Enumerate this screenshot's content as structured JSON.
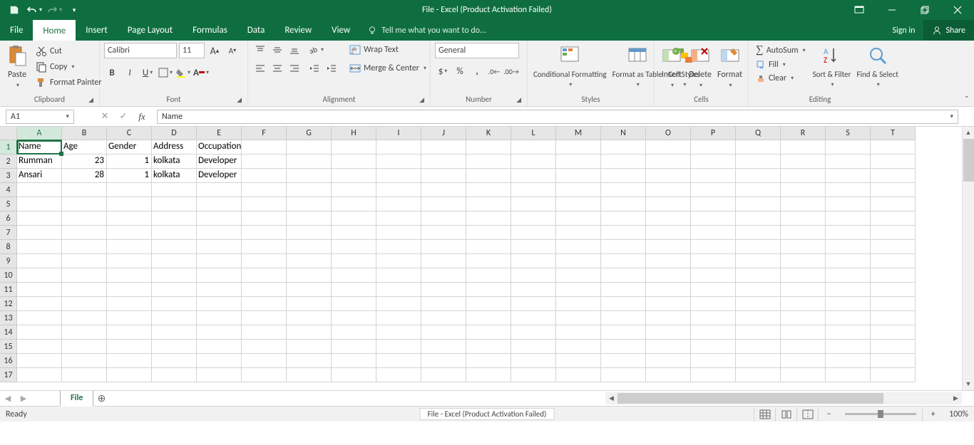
{
  "title": "File - Excel (Product Activation Failed)",
  "qat": {
    "save": "save",
    "undo": "undo",
    "redo": "redo"
  },
  "menu": {
    "tabs": [
      "File",
      "Home",
      "Insert",
      "Page Layout",
      "Formulas",
      "Data",
      "Review",
      "View"
    ],
    "tellme": "Tell me what you want to do...",
    "signin": "Sign in",
    "share": "Share"
  },
  "ribbon": {
    "clipboard": {
      "paste": "Paste",
      "cut": "Cut",
      "copy": "Copy",
      "fmtpainter": "Format Painter",
      "label": "Clipboard"
    },
    "font": {
      "name": "Calibri",
      "size": "11",
      "label": "Font"
    },
    "alignment": {
      "wrap": "Wrap Text",
      "merge": "Merge & Center",
      "label": "Alignment"
    },
    "number": {
      "fmt": "General",
      "label": "Number"
    },
    "styles": {
      "cond": "Conditional Formatting",
      "table": "Format as Table",
      "cell": "Cell Styles",
      "label": "Styles"
    },
    "cells": {
      "insert": "Insert",
      "delete": "Delete",
      "format": "Format",
      "label": "Cells"
    },
    "editing": {
      "autosum": "AutoSum",
      "fill": "Fill",
      "clear": "Clear",
      "sort": "Sort & Filter",
      "find": "Find & Select",
      "label": "Editing"
    }
  },
  "namebox": "A1",
  "formula": "Name",
  "columns": [
    "A",
    "B",
    "C",
    "D",
    "E",
    "F",
    "G",
    "H",
    "I",
    "J",
    "K",
    "L",
    "M",
    "N",
    "O",
    "P",
    "Q",
    "R",
    "S",
    "T"
  ],
  "rows": [
    "1",
    "2",
    "3",
    "4",
    "5",
    "6",
    "7",
    "8",
    "9",
    "10",
    "11",
    "12",
    "13",
    "14",
    "15",
    "16",
    "17"
  ],
  "data": [
    [
      "Name",
      "Age",
      "Gender",
      "Address",
      "Occupation"
    ],
    [
      "Rumman",
      "23",
      "1",
      "kolkata",
      "Developer"
    ],
    [
      "Ansari",
      "28",
      "1",
      "kolkata",
      "Developer"
    ]
  ],
  "numeric_cols": [
    1,
    2
  ],
  "sheet": {
    "name": "File"
  },
  "status": {
    "ready": "Ready",
    "center": "File - Excel (Product Activation Failed)",
    "zoom": "100%"
  }
}
